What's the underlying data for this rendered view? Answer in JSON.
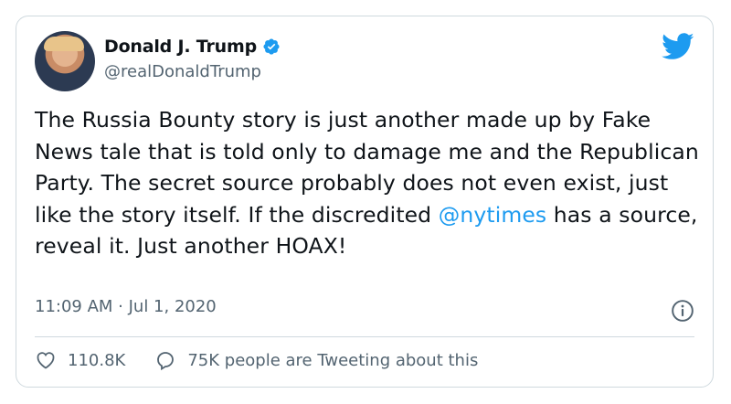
{
  "author": {
    "name": "Donald J. Trump",
    "handle": "@realDonaldTrump"
  },
  "tweet": {
    "text_before": "The Russia Bounty story is just another made up by Fake News tale that is told only to damage me and the Republican Party. The secret source probably does not even exist, just like the story itself. If the discredited ",
    "mention": "@nytimes",
    "text_after": " has a source, reveal it. Just another HOAX!"
  },
  "meta": {
    "timestamp": "11:09 AM · Jul 1, 2020"
  },
  "actions": {
    "likes": "110.8K",
    "replies_label": "75K people are Tweeting about this"
  },
  "colors": {
    "accent": "#1d9bf0",
    "secondary_text": "#536471",
    "border": "#cfd9de"
  }
}
